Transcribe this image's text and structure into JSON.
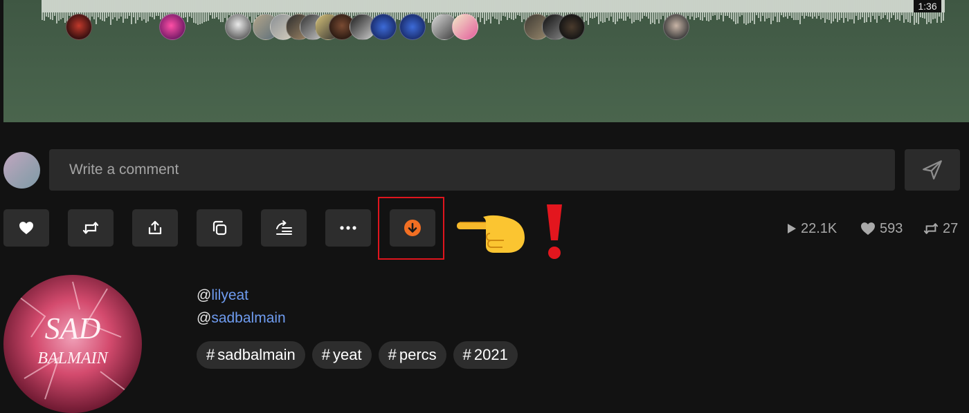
{
  "player": {
    "duration": "1:36",
    "comment_avatars": [
      "commenter-avatar",
      "commenter-avatar",
      "commenter-avatar",
      "commenter-avatar",
      "commenter-avatar",
      "commenter-avatar",
      "commenter-avatar",
      "commenter-avatar",
      "commenter-avatar",
      "commenter-avatar",
      "commenter-avatar",
      "commenter-avatar",
      "commenter-avatar",
      "commenter-avatar",
      "commenter-avatar",
      "commenter-avatar",
      "commenter-avatar",
      "commenter-avatar"
    ]
  },
  "comment": {
    "placeholder": "Write a comment"
  },
  "actions": {
    "items": [
      {
        "name": "like-button",
        "icon": "heart-icon"
      },
      {
        "name": "repost-button",
        "icon": "repost-icon"
      },
      {
        "name": "share-button",
        "icon": "share-icon"
      },
      {
        "name": "copy-link-button",
        "icon": "copy-icon"
      },
      {
        "name": "add-to-next-up-button",
        "icon": "queue-icon"
      },
      {
        "name": "more-button",
        "icon": "more-icon"
      },
      {
        "name": "download-button",
        "icon": "download-icon",
        "accent": "#f26f23"
      }
    ]
  },
  "annotation": {
    "box_color": "#e0151d",
    "pointer": "pointing-hand-icon",
    "exclamation": "exclamation-icon"
  },
  "stats": {
    "plays": "22.1K",
    "likes": "593",
    "reposts": "27"
  },
  "description": {
    "mention1_prefix": "@",
    "mention1": "lilyeat",
    "mention2_prefix": "@",
    "mention2": "sadbalmain",
    "link_color": "#6f9cf0"
  },
  "tags": [
    {
      "hash": "#",
      "label": "sadbalmain"
    },
    {
      "hash": "#",
      "label": "yeat"
    },
    {
      "hash": "#",
      "label": "percs"
    },
    {
      "hash": "#",
      "label": "2021"
    }
  ],
  "cover": {
    "text_line1": "SAD",
    "text_line2": "BALMAIN"
  }
}
